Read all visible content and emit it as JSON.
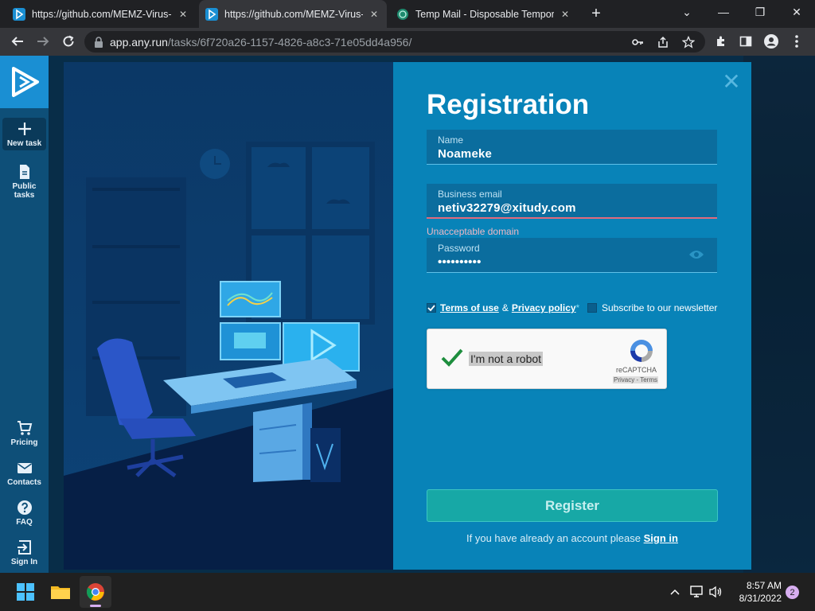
{
  "browser": {
    "tabs": [
      {
        "title": "https://github.com/MEMZ-Virus-",
        "favicon": "anyrun-icon",
        "active": false
      },
      {
        "title": "https://github.com/MEMZ-Virus-",
        "favicon": "anyrun-icon",
        "active": true
      },
      {
        "title": "Temp Mail - Disposable Tempora",
        "favicon": "tempmail-icon",
        "active": false
      }
    ],
    "new_tab": "+",
    "url_host": "app.any.run",
    "url_path": "/tasks/6f720a26-1157-4826-a8c3-71e05dd4a956/"
  },
  "sidebar": {
    "items": [
      {
        "label": "New task",
        "icon": "plus-icon"
      },
      {
        "label": "Public tasks",
        "icon": "document-icon"
      },
      {
        "label": "Pricing",
        "icon": "cart-icon"
      },
      {
        "label": "Contacts",
        "icon": "mail-icon"
      },
      {
        "label": "FAQ",
        "icon": "help-icon"
      },
      {
        "label": "Sign In",
        "icon": "signin-icon"
      }
    ]
  },
  "form": {
    "title": "Registration",
    "name": {
      "label": "Name",
      "value": "Noameke"
    },
    "email": {
      "label": "Business email",
      "value": "netiv32279@xitudy.com",
      "error": "Unacceptable domain"
    },
    "password": {
      "label": "Password",
      "value": "••••••••••"
    },
    "terms_of_use": "Terms of use",
    "amp": "&",
    "privacy_policy": "Privacy policy",
    "required_mark": "*",
    "terms_checked": true,
    "newsletter": "Subscribe to our newsletter",
    "newsletter_checked": false,
    "captcha": {
      "label": "I'm not a robot",
      "brand": "reCAPTCHA",
      "links": "Privacy - Terms",
      "checked": true
    },
    "register": "Register",
    "signin_prompt": "If you have already an account please",
    "signin_link": "Sign in"
  },
  "taskbar": {
    "time": "8:57 AM",
    "date": "8/31/2022",
    "notifications": "2"
  },
  "colors": {
    "panel": "#0883b8",
    "sidebar": "#0e4f78",
    "register_button": "#17a8a6",
    "error": "#e06a7d"
  }
}
